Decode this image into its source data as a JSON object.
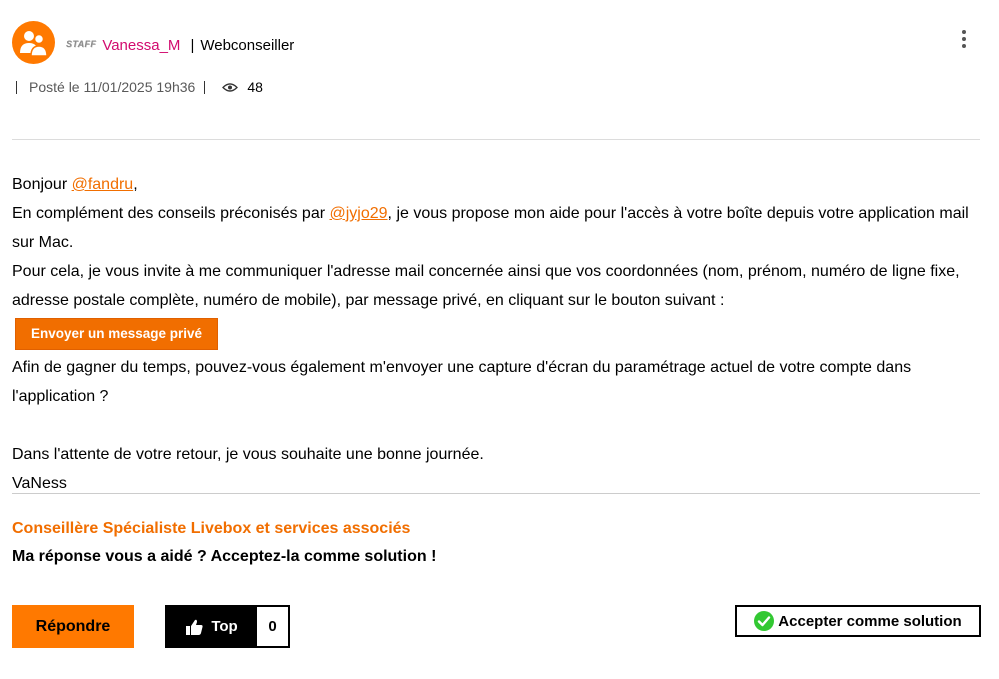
{
  "author": {
    "badge": "STAFF",
    "name": "Vanessa_M",
    "role": "Webconseiller"
  },
  "meta": {
    "posted": "Posté le 11/01/2025 19h36",
    "views": "48"
  },
  "content": {
    "greeting_prefix": "Bonjour ",
    "greeting_mention": "@fandru",
    "greeting_suffix": ",",
    "line1_prefix": "En complément des conseils préconisés par ",
    "line1_mention": "@jyjo29",
    "line1_suffix": ", je vous propose mon aide pour l'accès à votre boîte depuis votre application mail sur Mac.",
    "line2": "Pour cela, je vous invite à me communiquer l'adresse mail concernée ainsi que vos coordonnées (nom, prénom, numéro de ligne fixe, adresse postale complète, numéro de mobile), par message privé, en cliquant sur le bouton suivant :",
    "private_message_button": "Envoyer un message privé",
    "line3": "Afin de gagner du temps, pouvez-vous également m'envoyer une capture d'écran du paramétrage actuel de votre compte dans l'application ?",
    "closing": "Dans l'attente de votre retour, je vous souhaite une bonne journée.",
    "sign": "VaNess"
  },
  "signature": {
    "title": "Conseillère Spécialiste Livebox et services associés",
    "prompt": "Ma réponse vous a aidé ? Acceptez-la comme solution !"
  },
  "actions": {
    "reply": "Répondre",
    "top_label": "Top",
    "top_count": "0",
    "accept": "Accepter comme solution"
  },
  "colors": {
    "accent": "#ff7900",
    "mention": "#f16e00",
    "author_name": "#d20a6e",
    "check": "#32c832"
  }
}
